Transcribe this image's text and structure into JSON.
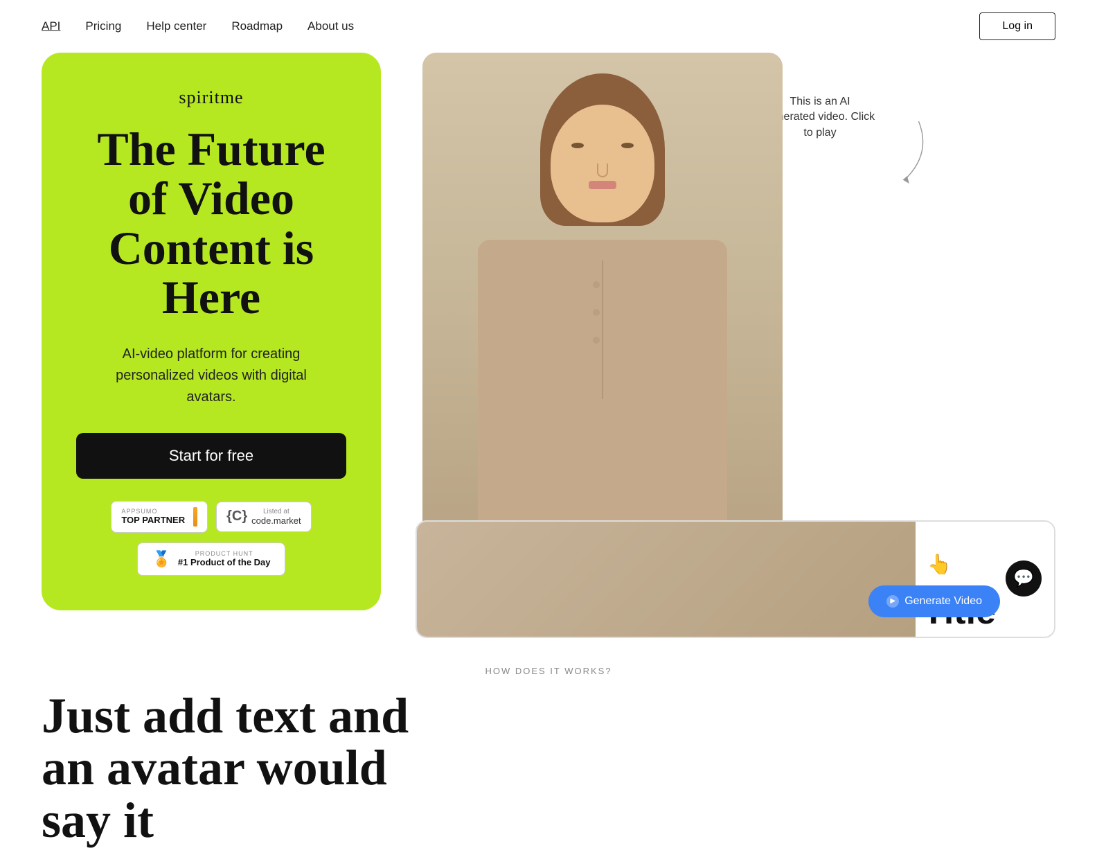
{
  "nav": {
    "links": [
      {
        "label": "API",
        "underlined": true
      },
      {
        "label": "Pricing",
        "underlined": false
      },
      {
        "label": "Help center",
        "underlined": false
      },
      {
        "label": "Roadmap",
        "underlined": false
      },
      {
        "label": "About us",
        "underlined": false
      }
    ],
    "login_label": "Log in"
  },
  "hero": {
    "brand": "spiritme",
    "title": "The Future of Video Content is Here",
    "subtitle": "AI-video platform for creating personalized videos with digital avatars.",
    "cta_label": "Start for free",
    "badges": {
      "appsumo_label": "APPSUMO",
      "appsumo_partner": "TOP PARTNER",
      "code_market_label": "Listed at",
      "code_market_name": "code.market",
      "product_hunt_label": "PRODUCT HUNT",
      "product_hunt_title": "#1 Product of the Day"
    }
  },
  "ai_tooltip": {
    "text": "This is an AI generated video. Click to play"
  },
  "generate_btn": {
    "label": "Generate Video"
  },
  "how_section": {
    "label": "HOW DOES IT WORKS?",
    "title_line1": "Just add text and",
    "title_line2": "an avatar would",
    "title_line3": "say it"
  },
  "video_preview": {
    "title_text": "Title"
  }
}
